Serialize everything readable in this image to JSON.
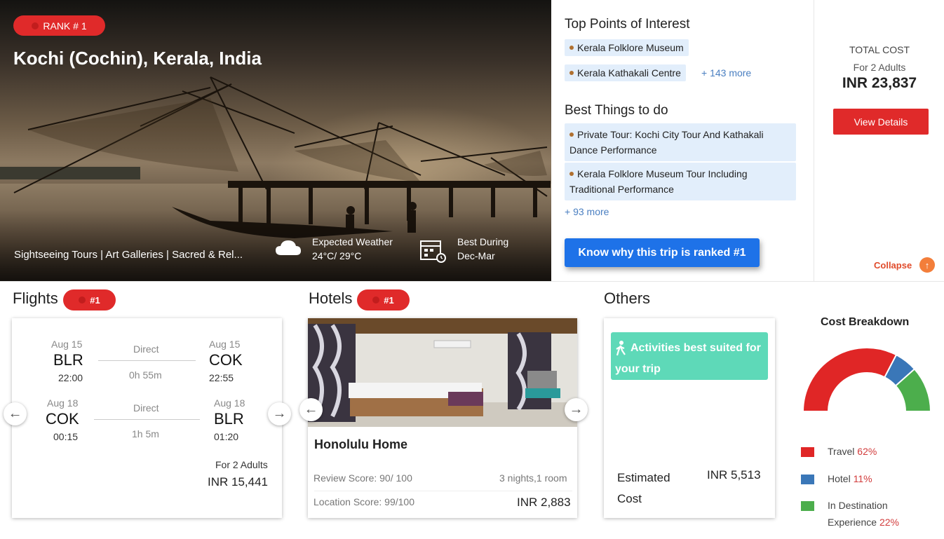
{
  "hero": {
    "rank_badge": "RANK # 1",
    "title": "Kochi (Cochin), Kerala, India",
    "tags": "Sightseeing Tours | Art Galleries | Sacred & Rel...",
    "weather_label": "Expected Weather",
    "weather_value": "24°C/ 29°C",
    "best_label": "Best During",
    "best_value": "Dec-Mar"
  },
  "poi": {
    "title": "Top Points of Interest",
    "items": [
      "Kerala Folklore Museum",
      "Kerala Kathakali Centre"
    ],
    "more": "+ 143 more"
  },
  "things": {
    "title": "Best Things to do",
    "items": [
      "Private Tour: Kochi City Tour And Kathakali Dance Performance",
      "Kerala Folklore Museum Tour Including Traditional Performance"
    ],
    "more": "+ 93 more"
  },
  "why_button": "Know why this trip is ranked #1",
  "cost": {
    "label": "TOTAL COST",
    "sub": "For 2 Adults",
    "amount": "INR 23,837",
    "view_button": "View Details",
    "collapse": "Collapse"
  },
  "flights": {
    "title": "Flights",
    "rank": "#1",
    "legs": [
      {
        "from_date": "Aug 15",
        "from_code": "BLR",
        "from_time": "22:00",
        "type": "Direct",
        "duration": "0h 55m",
        "to_date": "Aug 15",
        "to_code": "COK",
        "to_time": "22:55"
      },
      {
        "from_date": "Aug 18",
        "from_code": "COK",
        "from_time": "00:15",
        "type": "Direct",
        "duration": "1h 5m",
        "to_date": "Aug 18",
        "to_code": "BLR",
        "to_time": "01:20"
      }
    ],
    "for": "For 2 Adults",
    "price": "INR 15,441"
  },
  "hotels": {
    "title": "Hotels",
    "rank": "#1",
    "name": "Honolulu Home",
    "review": "Review Score: 90/ 100",
    "stay": "3 nights,1 room",
    "location": "Location Score: 99/100",
    "price": "INR 2,883"
  },
  "others": {
    "title": "Others",
    "activity": "Activities best suited for your trip",
    "est_label": "Estimated Cost",
    "est_value": "INR 5,513"
  },
  "breakdown": {
    "title": "Cost Breakdown",
    "items": [
      {
        "label": "Travel",
        "pct": "62%",
        "value": 62,
        "color": "#e02626"
      },
      {
        "label": "Hotel",
        "pct": "11%",
        "value": 11,
        "color": "#3a77b8"
      },
      {
        "label": "In Destination Experience",
        "pct": "22%",
        "value": 22,
        "color": "#4cae4c"
      }
    ]
  }
}
